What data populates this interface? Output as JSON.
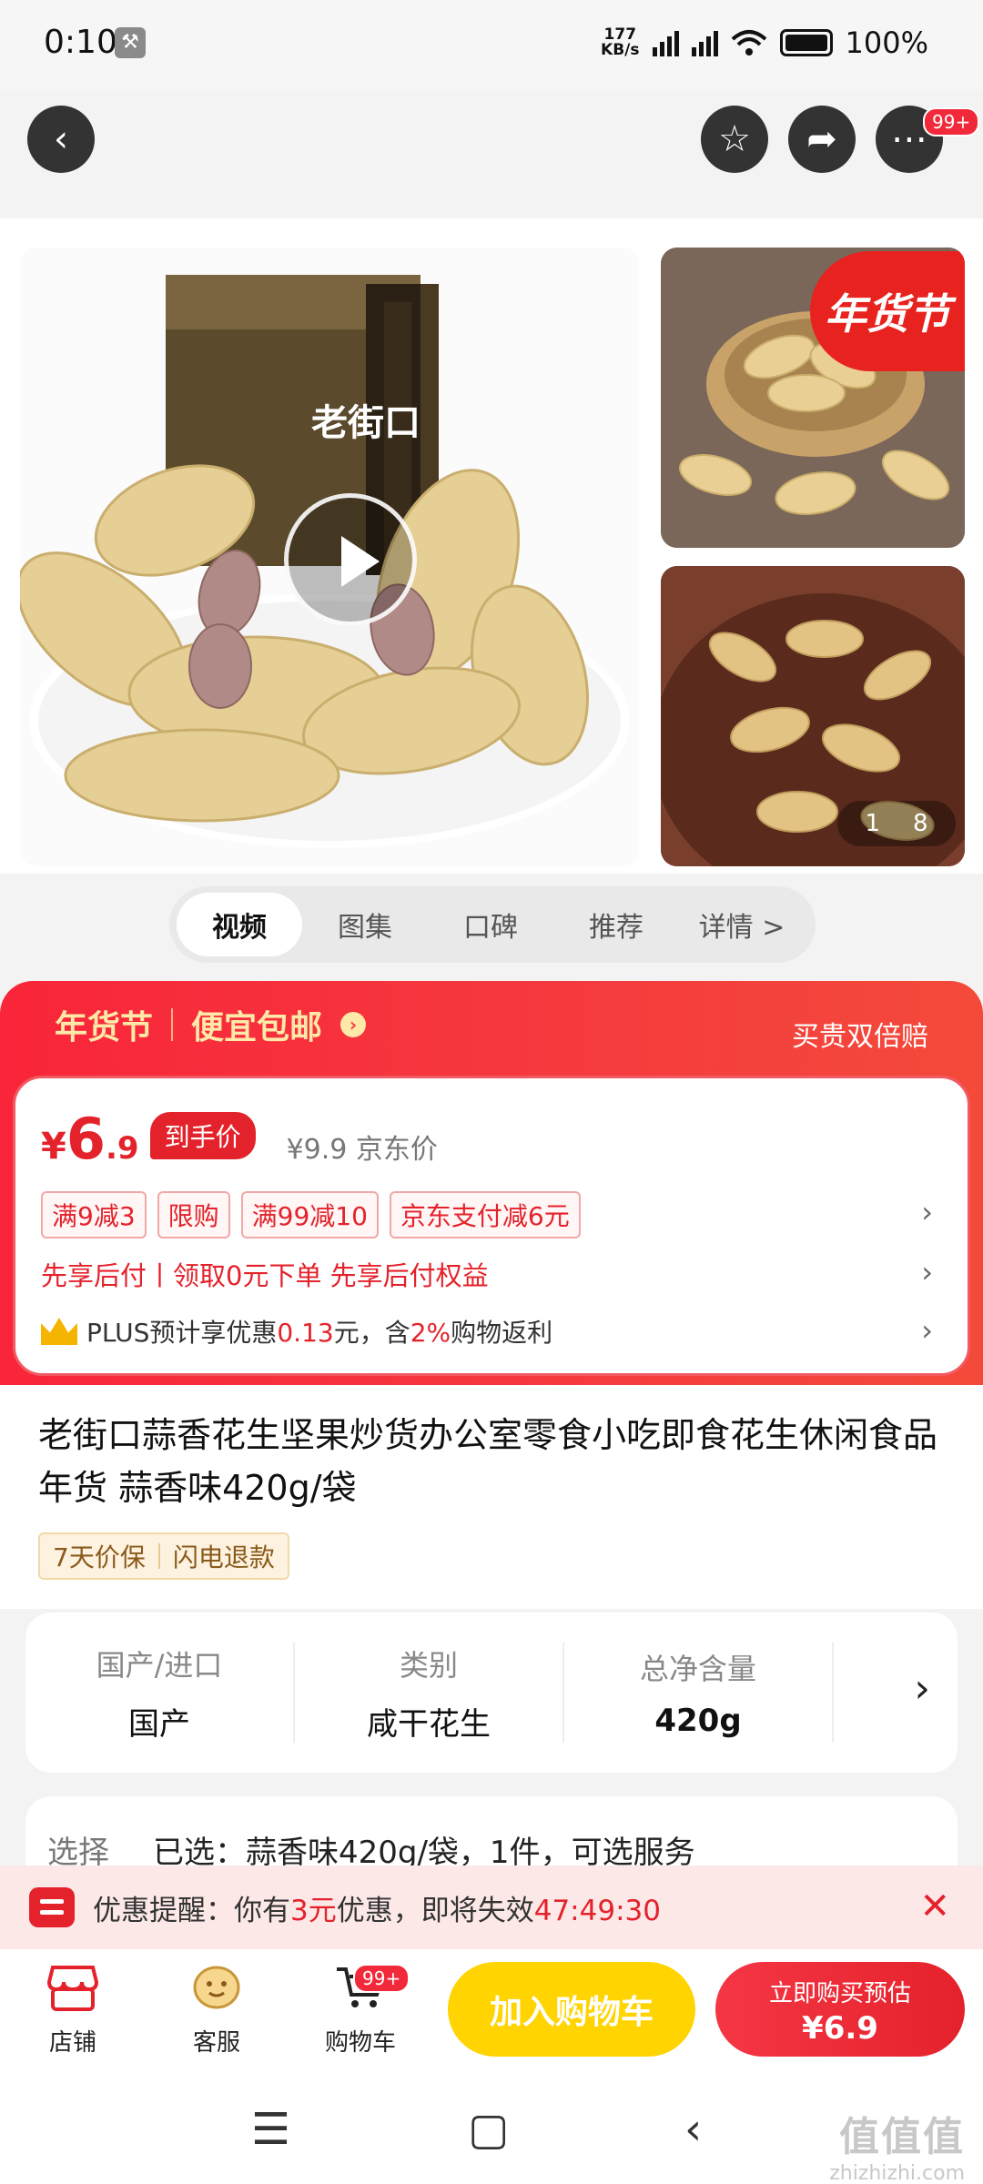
{
  "status": {
    "time": "0:10",
    "net_speed_value": "177",
    "net_speed_unit": "KB/s",
    "battery": "100%"
  },
  "nav": {
    "more_badge": "99+"
  },
  "gallery": {
    "festival_badge": "年货节",
    "brand_text": "老街口",
    "counter_current": "1",
    "counter_total": "8"
  },
  "tabs": [
    {
      "label": "视频",
      "active": true
    },
    {
      "label": "图集",
      "active": false
    },
    {
      "label": "口碑",
      "active": false
    },
    {
      "label": "推荐",
      "active": false
    },
    {
      "label": "详情 >",
      "active": false
    }
  ],
  "promo": {
    "festival": "年货节",
    "headline": "便宜包邮",
    "right_text": "买贵双倍赔",
    "price_symbol": "¥",
    "price_int": "6",
    "price_dec": ".9",
    "price_tag": "到手价",
    "orig_price": "¥9.9 京东价",
    "coupons": [
      "满9减3",
      "限购",
      "满99减10",
      "京东支付减6元"
    ],
    "pay_later": "先享后付丨领取0元下单 先享后付权益",
    "plus_prefix": "PLUS预计享优惠",
    "plus_amount": "0.13",
    "plus_mid": "元，含",
    "plus_pct": "2%",
    "plus_suffix": "购物返利"
  },
  "product": {
    "title": "老街口蒜香花生坚果炒货办公室零食小吃即食花生休闲食品年货 蒜香味420g/袋",
    "guarantees": [
      "7天价保",
      "闪电退款"
    ]
  },
  "specs": [
    {
      "label": "国产/进口",
      "value": "国产"
    },
    {
      "label": "类别",
      "value": "咸干花生"
    },
    {
      "label": "总净含量",
      "value": "420g"
    }
  ],
  "select": {
    "label": "选择",
    "value": "已选：蒜香味420g/袋，1件，可选服务"
  },
  "reminder": {
    "prefix": "优惠提醒：你有",
    "amount": "3元",
    "mid": "优惠，即将失效",
    "countdown": "47:49:30"
  },
  "bottom": {
    "shop": "店铺",
    "service": "客服",
    "cart": "购物车",
    "cart_badge": "99+",
    "add_cart": "加入购物车",
    "buy_line1": "立即购买预估",
    "buy_line2": "¥6.9"
  },
  "watermark": {
    "main": "值值值",
    "sub": "zhizhizhi.com"
  },
  "colors": {
    "brand_red": "#e4222b",
    "cart_yellow": "#ffd400",
    "promo_red": "#f9253a"
  }
}
